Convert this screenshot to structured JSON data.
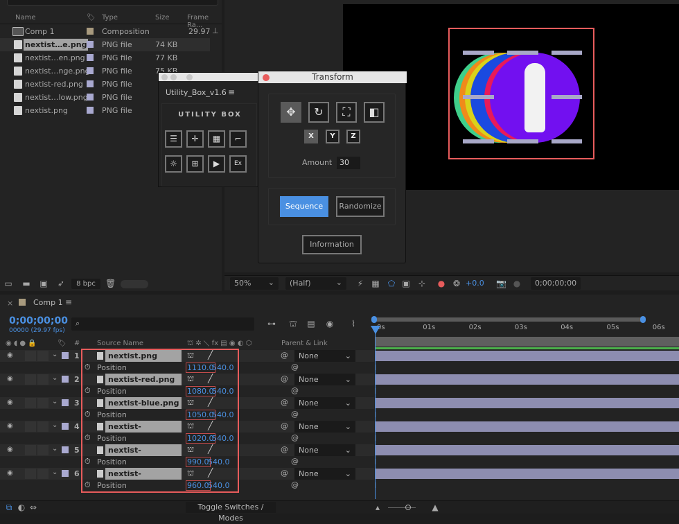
{
  "project": {
    "columns": {
      "name": "Name",
      "type": "Type",
      "size": "Size",
      "frame": "Frame Ra..."
    },
    "items": [
      {
        "name": "Comp 1",
        "type": "Composition",
        "size": "",
        "frame": "29.97",
        "label_color": "#a89a7e",
        "icon": "composition-icon",
        "selected": false
      },
      {
        "name": "nextist…e.png",
        "type": "PNG file",
        "size": "74 KB",
        "frame": "",
        "label_color": "#a9a9d0",
        "icon": "png-file-icon",
        "selected": true
      },
      {
        "name": "nextist…en.png",
        "type": "PNG file",
        "size": "77 KB",
        "frame": "",
        "label_color": "#a9a9d0",
        "icon": "png-file-icon",
        "selected": false
      },
      {
        "name": "nextist…nge.png",
        "type": "PNG file",
        "size": "75 KB",
        "frame": "",
        "label_color": "#a9a9d0",
        "icon": "png-file-icon",
        "selected": false
      },
      {
        "name": "nextist-red.png",
        "type": "PNG file",
        "size": "",
        "frame": "",
        "label_color": "#a9a9d0",
        "icon": "png-file-icon",
        "selected": false
      },
      {
        "name": "nextist…low.png",
        "type": "PNG file",
        "size": "",
        "frame": "",
        "label_color": "#a9a9d0",
        "icon": "png-file-icon",
        "selected": false
      },
      {
        "name": "nextist.png",
        "type": "PNG file",
        "size": "",
        "frame": "",
        "label_color": "#a9a9d0",
        "icon": "png-file-icon",
        "selected": false
      }
    ],
    "bpc": "8 bpc"
  },
  "utility_box": {
    "title": "Utility_Box_v1.6",
    "logo": "UTILITY BOX",
    "buttons": [
      "align-icon",
      "anchor-icon",
      "grid-icon",
      "corner-icon",
      "sun-icon",
      "split-icon",
      "camera-icon",
      "Ex"
    ]
  },
  "transform": {
    "title": "Transform",
    "modes": [
      "move-icon",
      "rotate-icon",
      "scale-icon",
      "opacity-icon"
    ],
    "axes": [
      "X",
      "Y",
      "Z"
    ],
    "amount_label": "Amount",
    "amount_value": "30",
    "sequence_label": "Sequence",
    "randomize_label": "Randomize",
    "information_label": "Information"
  },
  "viewer": {
    "zoom": "50%",
    "resolution": "(Half)",
    "exposure": "+0.0",
    "timecode": "0;00;00;00"
  },
  "timeline": {
    "comp_name": "Comp 1",
    "timecode": "0;00;00;00",
    "fps": "00000 (29.97 fps)",
    "source_name_header": "Source Name",
    "parent_header": "Parent & Link",
    "hash_header": "#",
    "ticks": [
      "0s",
      "01s",
      "02s",
      "03s",
      "04s",
      "05s",
      "06s"
    ],
    "layers": [
      {
        "num": "1",
        "name": "nextist.png",
        "prop": "Position",
        "x": "1110.0",
        "y": "540.0",
        "parent": "None"
      },
      {
        "num": "2",
        "name": "nextist-red.png",
        "prop": "Position",
        "x": "1080.0",
        "y": "540.0",
        "parent": "None"
      },
      {
        "num": "3",
        "name": "nextist-blue.png",
        "prop": "Position",
        "x": "1050.0",
        "y": "540.0",
        "parent": "None"
      },
      {
        "num": "4",
        "name": "nextist-yellow.png",
        "prop": "Position",
        "x": "1020.0",
        "y": "540.0",
        "parent": "None"
      },
      {
        "num": "5",
        "name": "nextist-orange.png",
        "prop": "Position",
        "x": "990.0",
        "y": "540.0",
        "parent": "None"
      },
      {
        "num": "6",
        "name": "nextist-green.png",
        "prop": "Position",
        "x": "960.0",
        "y": "540.0",
        "parent": "None"
      }
    ],
    "toggle_label": "Toggle Switches / Modes"
  },
  "colors": {
    "accent": "#4a90e2",
    "highlight": "#e85c5c",
    "track": "#8d8db0"
  }
}
